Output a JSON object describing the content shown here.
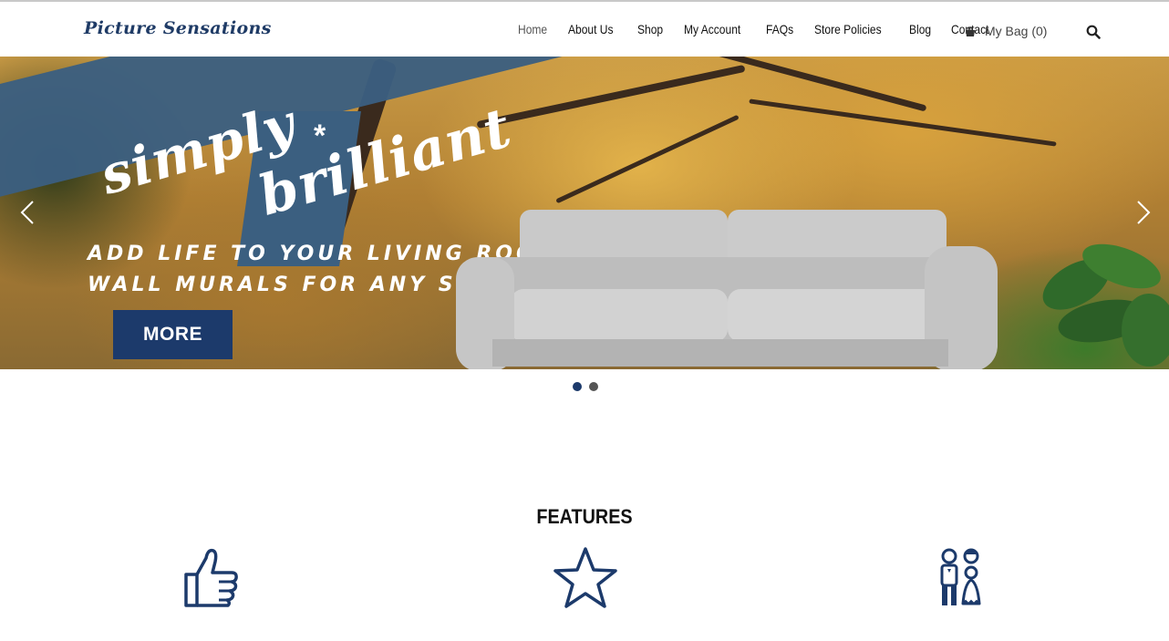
{
  "header": {
    "logo": "Picture Sensations",
    "nav": [
      {
        "label": "Home",
        "active": true
      },
      {
        "label": "About Us"
      },
      {
        "label": "Shop"
      },
      {
        "label": "My Account"
      },
      {
        "label": "FAQs"
      },
      {
        "label": "Store Policies"
      },
      {
        "label": "Blog"
      },
      {
        "label": "Contact"
      }
    ],
    "bag_label": "My Bag (0)",
    "icons": {
      "bag": "shopping-bag-icon",
      "search": "search-icon"
    }
  },
  "hero": {
    "script_line1": "simply",
    "script_line2": "brilliant",
    "asterisk": "*",
    "tagline1": "ADD LIFE TO YOUR LIVING ROOM",
    "tagline2": "WALL MURALS FOR ANY SEASON",
    "button_label": "MORE",
    "slides_total": 2,
    "active_slide": 1,
    "colors": {
      "ribbon": "#3b5f80",
      "button": "#1c3a6b"
    }
  },
  "features": {
    "title": "FEATURES",
    "icons": [
      "thumbs-up-icon",
      "star-icon",
      "couple-icon"
    ],
    "icon_color": "#1c3a6b"
  }
}
